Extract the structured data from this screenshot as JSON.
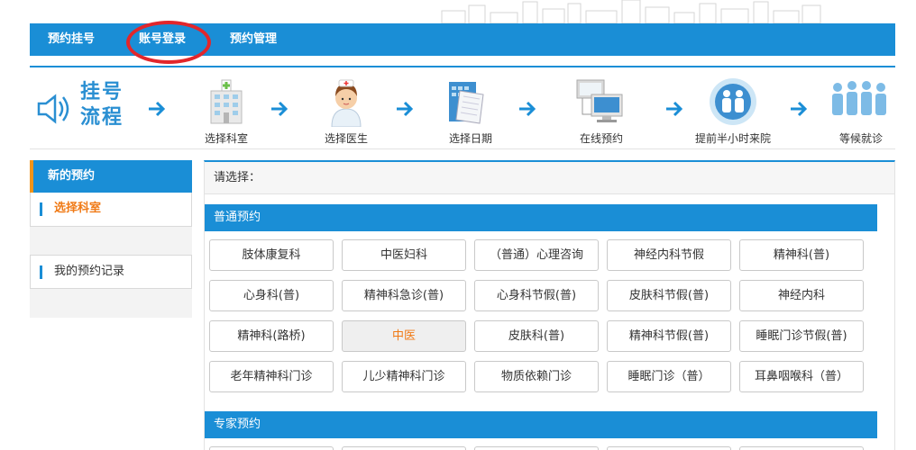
{
  "nav": {
    "items": [
      "预约挂号",
      "账号登录",
      "预约管理"
    ]
  },
  "process": {
    "title": "挂号流程",
    "steps": [
      {
        "label": "选择科室",
        "icon": "hospital-icon"
      },
      {
        "label": "选择医生",
        "icon": "nurse-icon"
      },
      {
        "label": "选择日期",
        "icon": "calendar-icon"
      },
      {
        "label": "在线预约",
        "icon": "computer-icon"
      },
      {
        "label": "提前半小时来院",
        "icon": "people-circle-icon"
      },
      {
        "label": "等候就诊",
        "icon": "waiting-people-icon"
      }
    ]
  },
  "sidebar": {
    "header": "新的预约",
    "items": [
      "选择科室",
      "我的预约记录"
    ]
  },
  "main": {
    "prompt": "请选择：",
    "sections": [
      "普通预约",
      "专家预约"
    ],
    "departments": [
      "肢体康复科",
      "中医妇科",
      "（普通）心理咨询",
      "神经内科节假",
      "精神科(普)",
      "心身科(普)",
      "精神科急诊(普)",
      "心身科节假(普)",
      "皮肤科节假(普)",
      "神经内科",
      "精神科(路桥)",
      "中医",
      "皮肤科(普)",
      "精神科节假(普)",
      "睡眠门诊节假(普)",
      "老年精神科门诊",
      "儿少精神科门诊",
      "物质依赖门诊",
      "睡眠门诊（普）",
      "耳鼻咽喉科（普）"
    ],
    "selected_department": "中医"
  },
  "colors": {
    "primary": "#1a8ed6",
    "accent": "#f07a16",
    "highlight_circle": "#e2262b"
  }
}
